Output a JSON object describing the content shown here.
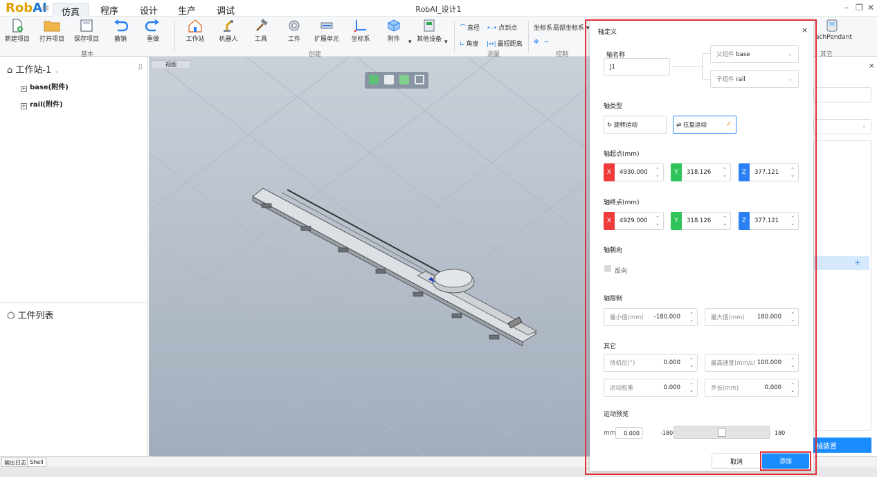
{
  "app": {
    "logo_rob": "Rob",
    "logo_ai": "AI",
    "window_title": "RobAI_设计1",
    "menu": [
      "仿真",
      "程序",
      "设计",
      "生产",
      "调试"
    ]
  },
  "ribbon": {
    "buttons": {
      "new_project": "新建项目",
      "open_project": "打开项目",
      "save_project": "保存项目",
      "undo": "撤销",
      "redo": "重做",
      "workstation": "工作站",
      "robot": "机器人",
      "tool": "工具",
      "workpiece": "工件",
      "ext_unit": "扩展单元",
      "coord": "坐标系",
      "attachment": "附件",
      "other_device": "其他设备"
    },
    "groups": {
      "basic": "基本",
      "create": "创建",
      "measure": "测量",
      "control": "控制",
      "other": "其它"
    },
    "measure_tools": {
      "diameter": "直径",
      "point_to_point": "点到点",
      "angle": "角度",
      "min_distance": "最短距离"
    },
    "coord_label": "坐标系",
    "coord_value": "局部坐标系",
    "teach_pendant": "achPendant"
  },
  "left_panel": {
    "workstation_title": "工作站-1",
    "tree_items": [
      "base(附件)",
      "rail(附件)"
    ],
    "workpiece_list_title": "工件列表"
  },
  "viewport": {
    "tab_label": "视图"
  },
  "bottom_tabs": [
    "输出日志",
    "Shell"
  ],
  "right_panel": {
    "add_icon": "+",
    "button_label": "械装置"
  },
  "dialog": {
    "title": "轴定义",
    "axis_name_label": "轴名称",
    "axis_name_value": "J1",
    "parent_label": "父组件",
    "parent_value": "base",
    "child_label": "子组件",
    "child_value": "rail",
    "axis_type_label": "轴类型",
    "rotary_label": "旋转运动",
    "linear_label": "往复运动",
    "start_label": "轴起点(mm)",
    "start": {
      "x": "4930.000",
      "y": "318.126",
      "z": "377.121"
    },
    "end_label": "轴终点(mm)",
    "end": {
      "x": "4929.000",
      "y": "318.126",
      "z": "377.121"
    },
    "direction_label": "轴朝向",
    "reverse_label": "反向",
    "limit_label": "轴限制",
    "min_label": "最小值(mm)",
    "min_value": "-180.000",
    "max_label": "最大值(mm)",
    "max_value": "180.000",
    "other_label": "其它",
    "standby_label": "待机位(°)",
    "standby_value": "0.000",
    "max_speed_label": "最高速度(mm/s)",
    "max_speed_value": "100.000",
    "weight_label": "运动权重",
    "weight_value": "0.000",
    "step_label": "步长(mm)",
    "step_value": "0.000",
    "preview_label": "运动预览",
    "preview_unit": "mm",
    "preview_value": "0.000",
    "slider_min": "-180",
    "slider_max": "180",
    "slider_fraction": 0.5,
    "cancel_label": "取消",
    "add_label": "添加",
    "axis_x": "X",
    "axis_y": "Y",
    "axis_z": "Z",
    "colors": {
      "x": "#f03b3b",
      "y": "#2fc45b",
      "z": "#2a7ff5",
      "primary": "#1a8cff"
    }
  }
}
